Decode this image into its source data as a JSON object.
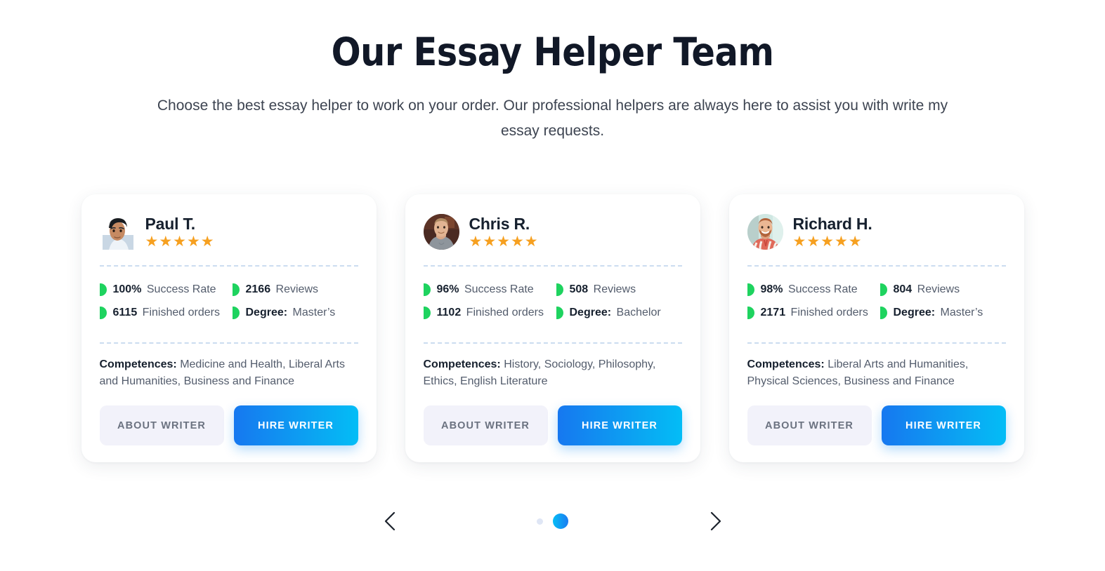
{
  "header": {
    "title": "Our Essay Helper Team",
    "subtitle": "Choose the best essay helper to work on your order. Our professional helpers are always here to assist you with write my essay requests."
  },
  "colors": {
    "accent_blue": "#1678f0",
    "accent_cyan": "#03bdf6",
    "bullet_green": "#1ed35f",
    "star_orange": "#f6a020",
    "divider_blue": "#cbdcf0",
    "about_button_bg": "#f2f2fa",
    "text_dark": "#16202e",
    "text_muted": "#535c6c"
  },
  "labels": {
    "success_rate": "Success Rate",
    "reviews": "Reviews",
    "finished_orders": "Finished orders",
    "degree_label": "Degree:",
    "competences_label": "Competences:",
    "about_writer": "ABOUT WRITER",
    "hire_writer": "HIRE WRITER",
    "stars": "★★★★★"
  },
  "cards": [
    {
      "name": "Paul T.",
      "avatar_icon": "avatar-photo-paul",
      "rating_stars": "★★★★★",
      "success_rate": "100%",
      "reviews": "2166",
      "finished_orders": "6115",
      "degree": "Master’s",
      "competences": "Medicine and Health, Liberal Arts and Humanities, Business and Finance"
    },
    {
      "name": "Chris R.",
      "avatar_icon": "avatar-photo-chris",
      "rating_stars": "★★★★★",
      "success_rate": "96%",
      "reviews": "508",
      "finished_orders": "1102",
      "degree": "Bachelor",
      "competences": "History, Sociology, Philosophy, Ethics, English Literature"
    },
    {
      "name": "Richard H.",
      "avatar_icon": "avatar-photo-richard",
      "rating_stars": "★★★★★",
      "success_rate": "98%",
      "reviews": "804",
      "finished_orders": "2171",
      "degree": "Master’s",
      "competences": "Liberal Arts and Humanities, Physical Sciences, Business and Finance"
    }
  ],
  "carousel": {
    "prev_icon": "chevron-left-icon",
    "next_icon": "chevron-right-icon",
    "dots": [
      {
        "state": "inactive"
      },
      {
        "state": "active"
      }
    ]
  }
}
